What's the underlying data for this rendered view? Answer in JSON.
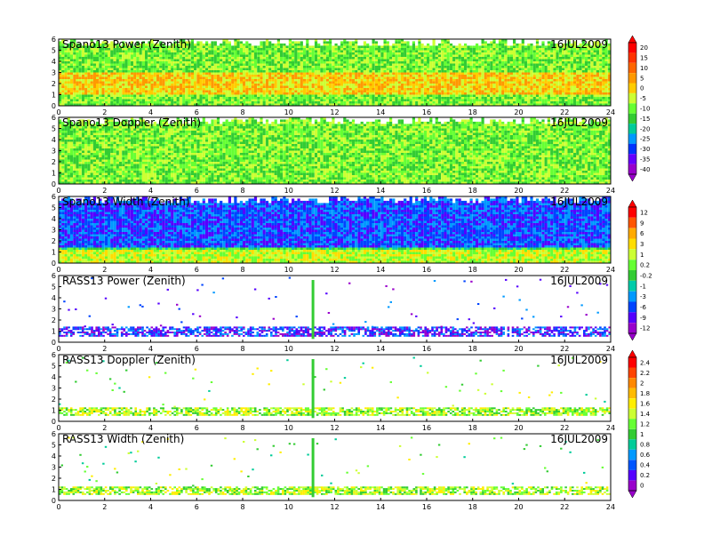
{
  "chart_data": [
    {
      "type": "heatmap",
      "title": "Spano13 Power (Zenith)",
      "date": "16JUL2009",
      "xlim": [
        0,
        24
      ],
      "ylim": [
        0,
        6
      ],
      "x_ticks": [
        0,
        2,
        4,
        6,
        8,
        10,
        12,
        14,
        16,
        18,
        20,
        22,
        24
      ],
      "y_ticks": [
        0,
        1,
        2,
        3,
        4,
        5,
        6
      ],
      "fill": "dense",
      "colorscale": "scale-a",
      "band_low": 1.0,
      "band_high": 3.0
    },
    {
      "type": "heatmap",
      "title": "Spano13 Doppler (Zenith)",
      "date": "16JUL2009",
      "xlim": [
        0,
        24
      ],
      "ylim": [
        0,
        6
      ],
      "x_ticks": [
        0,
        2,
        4,
        6,
        8,
        10,
        12,
        14,
        16,
        18,
        20,
        22,
        24
      ],
      "y_ticks": [
        0,
        1,
        2,
        3,
        4,
        5,
        6
      ],
      "fill": "dense",
      "colorscale": "scale-a"
    },
    {
      "type": "heatmap",
      "title": "Spano13 Width (Zenith)",
      "date": "16JUL2009",
      "xlim": [
        0,
        24
      ],
      "ylim": [
        0,
        6
      ],
      "x_ticks": [
        0,
        2,
        4,
        6,
        8,
        10,
        12,
        14,
        16,
        18,
        20,
        22,
        24
      ],
      "y_ticks": [
        0,
        1,
        2,
        3,
        4,
        5,
        6
      ],
      "fill": "dense",
      "colorscale": "scale-b",
      "band_low": 0.0,
      "band_high": 1.0
    },
    {
      "type": "heatmap",
      "title": "RASS13 Power (Zenith)",
      "date": "16JUL2009",
      "xlim": [
        0,
        24
      ],
      "ylim": [
        0,
        6
      ],
      "x_ticks": [
        0,
        2,
        4,
        6,
        8,
        10,
        12,
        14,
        16,
        18,
        20,
        22,
        24
      ],
      "y_ticks": [
        0,
        1,
        2,
        3,
        4,
        5,
        6
      ],
      "fill": "sparse",
      "colorscale": "scale-b",
      "band_low": 0.5,
      "band_high": 1.3,
      "spike_x": 11.0,
      "spike_top": 5.6
    },
    {
      "type": "heatmap",
      "title": "RASS13 Doppler (Zenith)",
      "date": "16JUL2009",
      "xlim": [
        0,
        24
      ],
      "ylim": [
        0,
        6
      ],
      "x_ticks": [
        0,
        2,
        4,
        6,
        8,
        10,
        12,
        14,
        16,
        18,
        20,
        22,
        24
      ],
      "y_ticks": [
        0,
        1,
        2,
        3,
        4,
        5,
        6
      ],
      "fill": "sparse",
      "colorscale": "scale-c",
      "band_low": 0.5,
      "band_high": 1.2,
      "spike_x": 11.0,
      "spike_top": 5.6
    },
    {
      "type": "heatmap",
      "title": "RASS13 Width (Zenith)",
      "date": "16JUL2009",
      "xlim": [
        0,
        24
      ],
      "ylim": [
        0,
        6
      ],
      "x_ticks": [
        0,
        2,
        4,
        6,
        8,
        10,
        12,
        14,
        16,
        18,
        20,
        22,
        24
      ],
      "y_ticks": [
        0,
        1,
        2,
        3,
        4,
        5,
        6
      ],
      "fill": "sparse",
      "colorscale": "scale-c",
      "band_low": 0.5,
      "band_high": 1.2,
      "spike_x": 11.0,
      "spike_top": 5.6
    }
  ],
  "colorbars": [
    {
      "id": "scale-a",
      "labels": [
        "20",
        "15",
        "10",
        "5",
        "0",
        "-5",
        "-10",
        "-15",
        "-20",
        "-25",
        "-30",
        "-35",
        "-40"
      ],
      "colors": [
        "#ff0000",
        "#ff3300",
        "#ff6600",
        "#ff9900",
        "#ffcc00",
        "#ccff33",
        "#66ff33",
        "#33cc33",
        "#00cc99",
        "#0099ff",
        "#0033ff",
        "#6600ff",
        "#9900cc"
      ]
    },
    {
      "id": "scale-b",
      "labels": [
        "12",
        "9",
        "6",
        "3",
        "1",
        "0.2",
        "-0.2",
        "-1",
        "-3",
        "-6",
        "-9",
        "-12"
      ],
      "colors": [
        "#ff0000",
        "#ff5500",
        "#ffaa00",
        "#ffdd00",
        "#ccff33",
        "#66ff33",
        "#33cc33",
        "#00ccaa",
        "#0099ff",
        "#0044ff",
        "#5500ff",
        "#9900cc"
      ]
    },
    {
      "id": "scale-c",
      "labels": [
        "2.4",
        "2.2",
        "2",
        "1.8",
        "1.6",
        "1.4",
        "1.2",
        "1",
        "0.8",
        "0.6",
        "0.4",
        "0.2",
        "0"
      ],
      "colors": [
        "#ff0000",
        "#ff4400",
        "#ff8800",
        "#ffbb00",
        "#ffee00",
        "#ccff33",
        "#66ff33",
        "#33cc33",
        "#00cc99",
        "#0099ff",
        "#0055ff",
        "#5500ff",
        "#9900cc"
      ]
    }
  ]
}
